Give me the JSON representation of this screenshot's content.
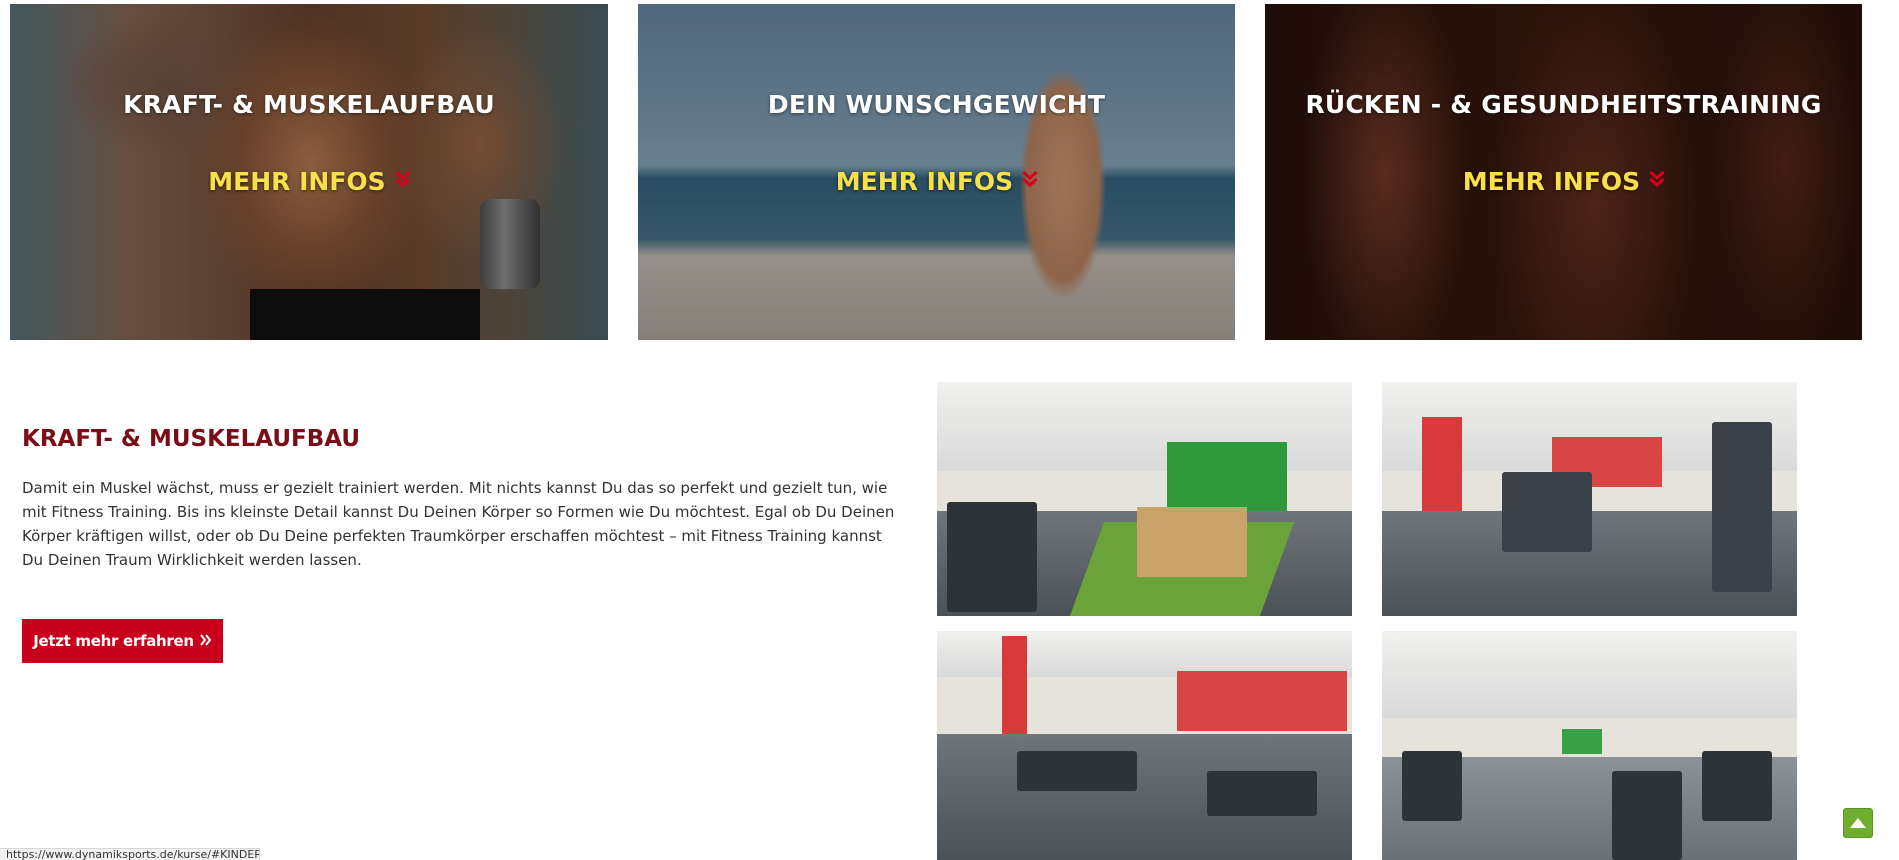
{
  "feature_cards": [
    {
      "title": "KRAFT- & MUSKELAUFBAU",
      "cta_label": "MEHR INFOS",
      "cta_icon": "double-chevron-down-icon",
      "cta_color": "#f7e04a",
      "icon_color": "#d6001c"
    },
    {
      "title": "DEIN WUNSCHGEWICHT",
      "cta_label": "MEHR INFOS",
      "cta_icon": "double-chevron-down-icon",
      "cta_color": "#f7e04a",
      "icon_color": "#d6001c"
    },
    {
      "title": "RÜCKEN - & GESUNDHEITSTRAINING",
      "cta_label": "MEHR INFOS",
      "cta_icon": "double-chevron-down-icon",
      "cta_color": "#f7e04a",
      "icon_color": "#d6001c"
    }
  ],
  "section": {
    "title": "KRAFT- & MUSKELAUFBAU",
    "title_color": "#7a0d16",
    "text": "Damit ein Muskel wächst, muss er gezielt trainiert werden. Mit nichts kannst Du das so perfekt und gezielt tun, wie mit Fitness Training. Bis ins kleinste Detail kannst Du Deinen Körper so Formen wie Du möchtest. Egal ob Du Deinen Körper kräftigen willst, oder ob Du Deine perfekten Traumkörper erschaffen möchtest – mit Fitness Training kannst Du Deinen Traum Wirklichkeit werden lassen.",
    "button_label": "Jetzt mehr erfahren",
    "button_icon": "double-chevron-right-icon",
    "button_color": "#c8001c"
  },
  "gallery": {
    "photos": [
      "gym-photo-functional-area",
      "gym-photo-free-weights",
      "gym-photo-bench-area",
      "gym-photo-machine-hall"
    ]
  },
  "status_bar": {
    "url": "https://www.dynamiksports.de/kurse/#KINDER"
  },
  "scroll_top": {
    "icon": "arrow-up-icon",
    "color": "#6fae2f"
  }
}
